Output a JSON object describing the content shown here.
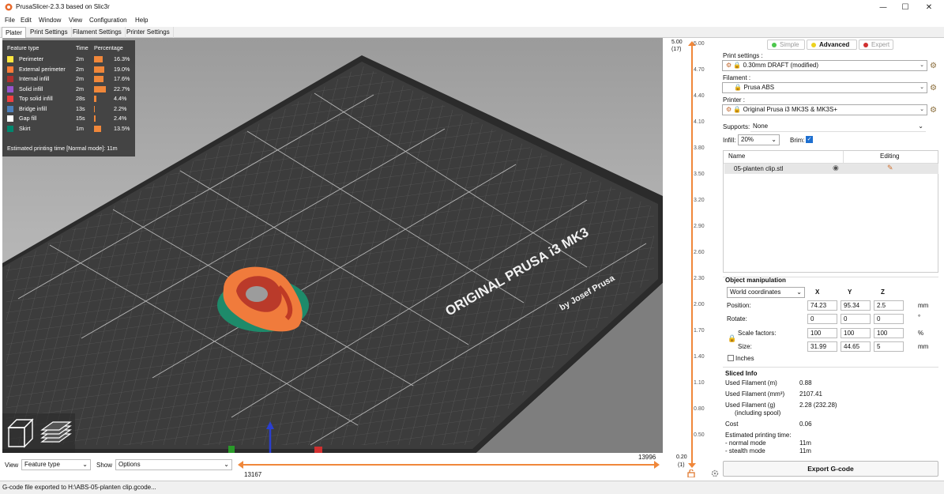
{
  "window": {
    "title": "PrusaSlicer-2.3.3 based on Slic3r",
    "minimize": "—",
    "maximize": "☐",
    "close": "✕"
  },
  "menu": [
    "File",
    "Edit",
    "Window",
    "View",
    "Configuration",
    "Help"
  ],
  "tabs": [
    "Plater",
    "Print Settings",
    "Filament Settings",
    "Printer Settings"
  ],
  "legend": {
    "headers": {
      "feature": "Feature type",
      "time": "Time",
      "percentage": "Percentage"
    },
    "rows": [
      {
        "name": "Perimeter",
        "time": "2m",
        "percent": "16.3%",
        "fraction": 0.163,
        "color": "#ffe640"
      },
      {
        "name": "External perimeter",
        "time": "2m",
        "percent": "19.0%",
        "fraction": 0.19,
        "color": "#ff7d38"
      },
      {
        "name": "Internal infill",
        "time": "2m",
        "percent": "17.6%",
        "fraction": 0.176,
        "color": "#b0302f"
      },
      {
        "name": "Solid infill",
        "time": "2m",
        "percent": "22.7%",
        "fraction": 0.227,
        "color": "#9654cc"
      },
      {
        "name": "Top solid infill",
        "time": "28s",
        "percent": "4.4%",
        "fraction": 0.044,
        "color": "#f04040"
      },
      {
        "name": "Bridge infill",
        "time": "13s",
        "percent": "2.2%",
        "fraction": 0.022,
        "color": "#4d80ba"
      },
      {
        "name": "Gap fill",
        "time": "15s",
        "percent": "2.4%",
        "fraction": 0.024,
        "color": "#ffffff"
      },
      {
        "name": "Skirt",
        "time": "1m",
        "percent": "13.5%",
        "fraction": 0.135,
        "color": "#00876e"
      }
    ],
    "estimated": "Estimated printing time [Normal mode]:   11m"
  },
  "bed_text": {
    "line1": "ORIGINAL PRUSA i3 MK3",
    "line2": "by Josef Prusa"
  },
  "vertical_slider": {
    "top_value": "5.00",
    "top_layer": "(17)",
    "bottom_value": "0.20",
    "bottom_layer": "(1)",
    "ticks": [
      "5.00",
      "4.70",
      "4.40",
      "4.10",
      "3.80",
      "3.50",
      "3.20",
      "2.90",
      "2.60",
      "2.30",
      "2.00",
      "1.70",
      "1.40",
      "1.10",
      "0.80",
      "0.50",
      "0.20"
    ]
  },
  "bottom_bar": {
    "view_label": "View",
    "view_value": "Feature type",
    "show_label": "Show",
    "show_value": "Options",
    "slider_left": "13167",
    "slider_right": "13996"
  },
  "mode": {
    "simple": "Simple",
    "advanced": "Advanced",
    "expert": "Expert"
  },
  "settings": {
    "print_label": "Print settings :",
    "print_value": "0.30mm DRAFT (modified)",
    "filament_label": "Filament :",
    "filament_value": "Prusa ABS",
    "printer_label": "Printer :",
    "printer_value": "Original Prusa i3 MK3S & MK3S+",
    "supports_label": "Supports:",
    "supports_value": "None",
    "infill_label": "Infill:",
    "infill_value": "20%",
    "brim_label": "Brim:",
    "brim_checked": "✓"
  },
  "object_list": {
    "col_name": "Name",
    "col_editing": "Editing",
    "items": [
      "05-planten clip.stl"
    ]
  },
  "manipulation": {
    "title": "Object manipulation",
    "coords": "World coordinates",
    "axes": [
      "X",
      "Y",
      "Z"
    ],
    "position_label": "Position:",
    "position": [
      "74.23",
      "95.34",
      "2.5"
    ],
    "position_unit": "mm",
    "rotate_label": "Rotate:",
    "rotate": [
      "0",
      "0",
      "0"
    ],
    "rotate_unit": "°",
    "scale_label": "Scale factors:",
    "scale": [
      "100",
      "100",
      "100"
    ],
    "scale_unit": "%",
    "size_label": "Size:",
    "size": [
      "31.99",
      "44.65",
      "5"
    ],
    "size_unit": "mm",
    "inches_label": "Inches"
  },
  "sliced_info": {
    "title": "Sliced Info",
    "rows": [
      {
        "label": "Used Filament (m)",
        "value": "0.88"
      },
      {
        "label": "Used Filament (mm³)",
        "value": "2107.41"
      },
      {
        "label": "Used Filament (g)",
        "value": "2.28 (232.28)"
      },
      {
        "label": "(including spool)",
        "value": ""
      },
      {
        "label": "Cost",
        "value": "0.06"
      },
      {
        "label": "Estimated printing time:",
        "value": ""
      },
      {
        "label": "- normal mode",
        "value": "11m"
      },
      {
        "label": "- stealth mode",
        "value": "11m"
      }
    ]
  },
  "export_label": "Export G-code",
  "status": "G-code file exported to H:\\ABS-05-planten clip.gcode..."
}
